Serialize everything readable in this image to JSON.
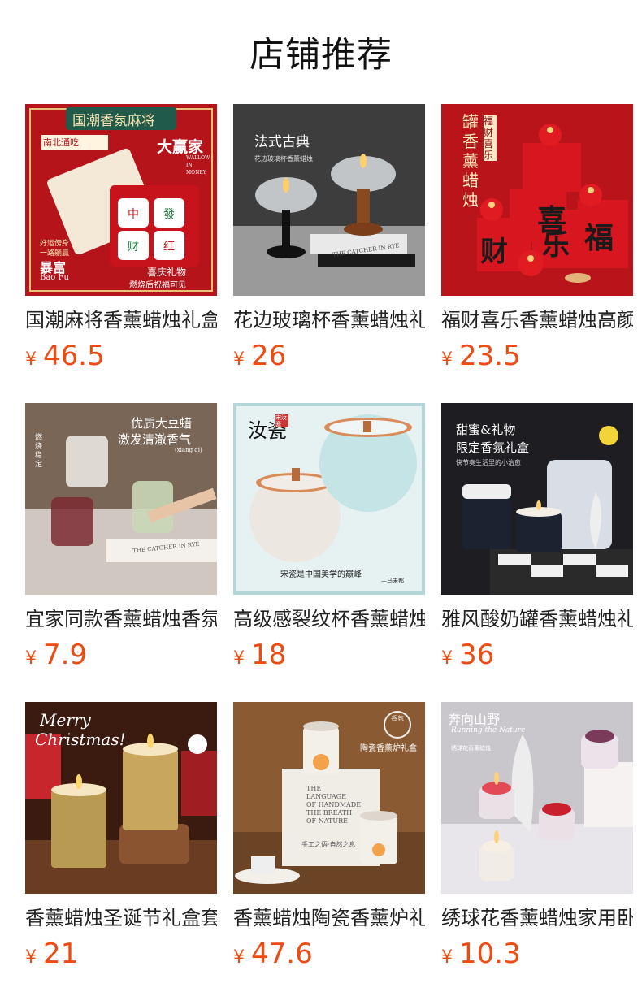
{
  "header": {
    "title": "店铺推荐"
  },
  "currency": "¥",
  "products": [
    {
      "name": "国潮麻将香薰蜡烛礼盒",
      "price": "46.5",
      "image": {
        "banner": "国潮香氛麻将",
        "tag": "南北通吃",
        "big": "大赢家",
        "small": "WALLOW IN MONEY",
        "left1": "好运傍身",
        "left2": "一路躺赢",
        "b1": "暴富",
        "b2": "Bao Fu",
        "r1": "喜庆礼物",
        "r2": "燃烧后祝福可见"
      }
    },
    {
      "name": "花边玻璃杯香薰蜡烛礼盒",
      "price": "26",
      "image": {
        "t1": "法式古典",
        "t2": "花边玻璃杯香薰蜡烛",
        "book": "THE CATCHER IN RYE"
      }
    },
    {
      "name": "福财喜乐香薰蜡烛高颜值",
      "price": "23.5",
      "image": {
        "v1": "罐香薰蜡烛",
        "v2": "福财喜乐",
        "c1": "喜",
        "c2": "财",
        "c3": "乐",
        "c4": "福"
      }
    },
    {
      "name": "宜家同款香薰蜡烛香氛礼盒",
      "price": "7.9",
      "image": {
        "t1": "优质大豆蜡",
        "t2": "激发清澈香气",
        "t3": "(xiang qi)",
        "side": "燃烧稳定",
        "book": "THE CATCHER IN RYE"
      }
    },
    {
      "name": "高级感裂纹杯香薰蜡烛礼盒",
      "price": "18",
      "image": {
        "t1": "汝瓷",
        "badge": "宋汝瓷",
        "t2": "宋瓷是中国美学的巅峰",
        "t3": "—马未都"
      }
    },
    {
      "name": "雅风酸奶罐香薰蜡烛礼盒",
      "price": "36",
      "image": {
        "t1": "甜蜜&礼物",
        "t2": "限定香氛礼盒",
        "t3": "快节奏生活里的小治愈"
      }
    },
    {
      "name": "香薰蜡烛圣诞节礼盒套装",
      "price": "21",
      "image": {
        "t1": "Merry",
        "t2": "Christmas!"
      }
    },
    {
      "name": "香薰蜡烛陶瓷香薰炉礼盒",
      "price": "47.6",
      "image": {
        "seal": "香氛",
        "t1": "陶瓷香薰炉礼盒",
        "box1": "THE",
        "box2": "LANGUAGE",
        "box3": "OF HANDMADE",
        "box4": "THE BREATH",
        "box5": "OF NATURE",
        "box6": "手工之语·自然之息"
      }
    },
    {
      "name": "绣球花香薰蜡烛家用卧室",
      "price": "10.3",
      "image": {
        "t1": "奔向山野",
        "t2": "Running the Nature",
        "t3": "绣球花香薰蜡烛"
      }
    }
  ]
}
